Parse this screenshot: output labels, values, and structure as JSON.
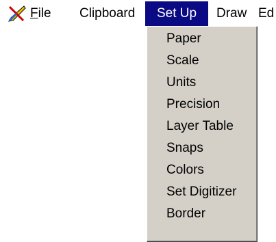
{
  "menubar": {
    "app_icon": "drafting-pencil-icon",
    "items": [
      {
        "label": "File",
        "mnemonic": "F",
        "rest": "ile"
      },
      {
        "label": "Clipboard"
      },
      {
        "label": "Set Up"
      },
      {
        "label": "Draw"
      },
      {
        "label": "Ed"
      }
    ]
  },
  "dropdown": {
    "items": [
      {
        "label": "Paper"
      },
      {
        "label": "Scale"
      },
      {
        "label": "Units"
      },
      {
        "label": "Precision"
      },
      {
        "label": "Layer Table"
      },
      {
        "label": "Snaps"
      },
      {
        "label": "Colors"
      },
      {
        "label": "Set Digitizer"
      },
      {
        "label": "Border"
      }
    ]
  },
  "colors": {
    "menu_highlight": "#0a0a85",
    "dropdown_bg": "#d4d0c8"
  }
}
